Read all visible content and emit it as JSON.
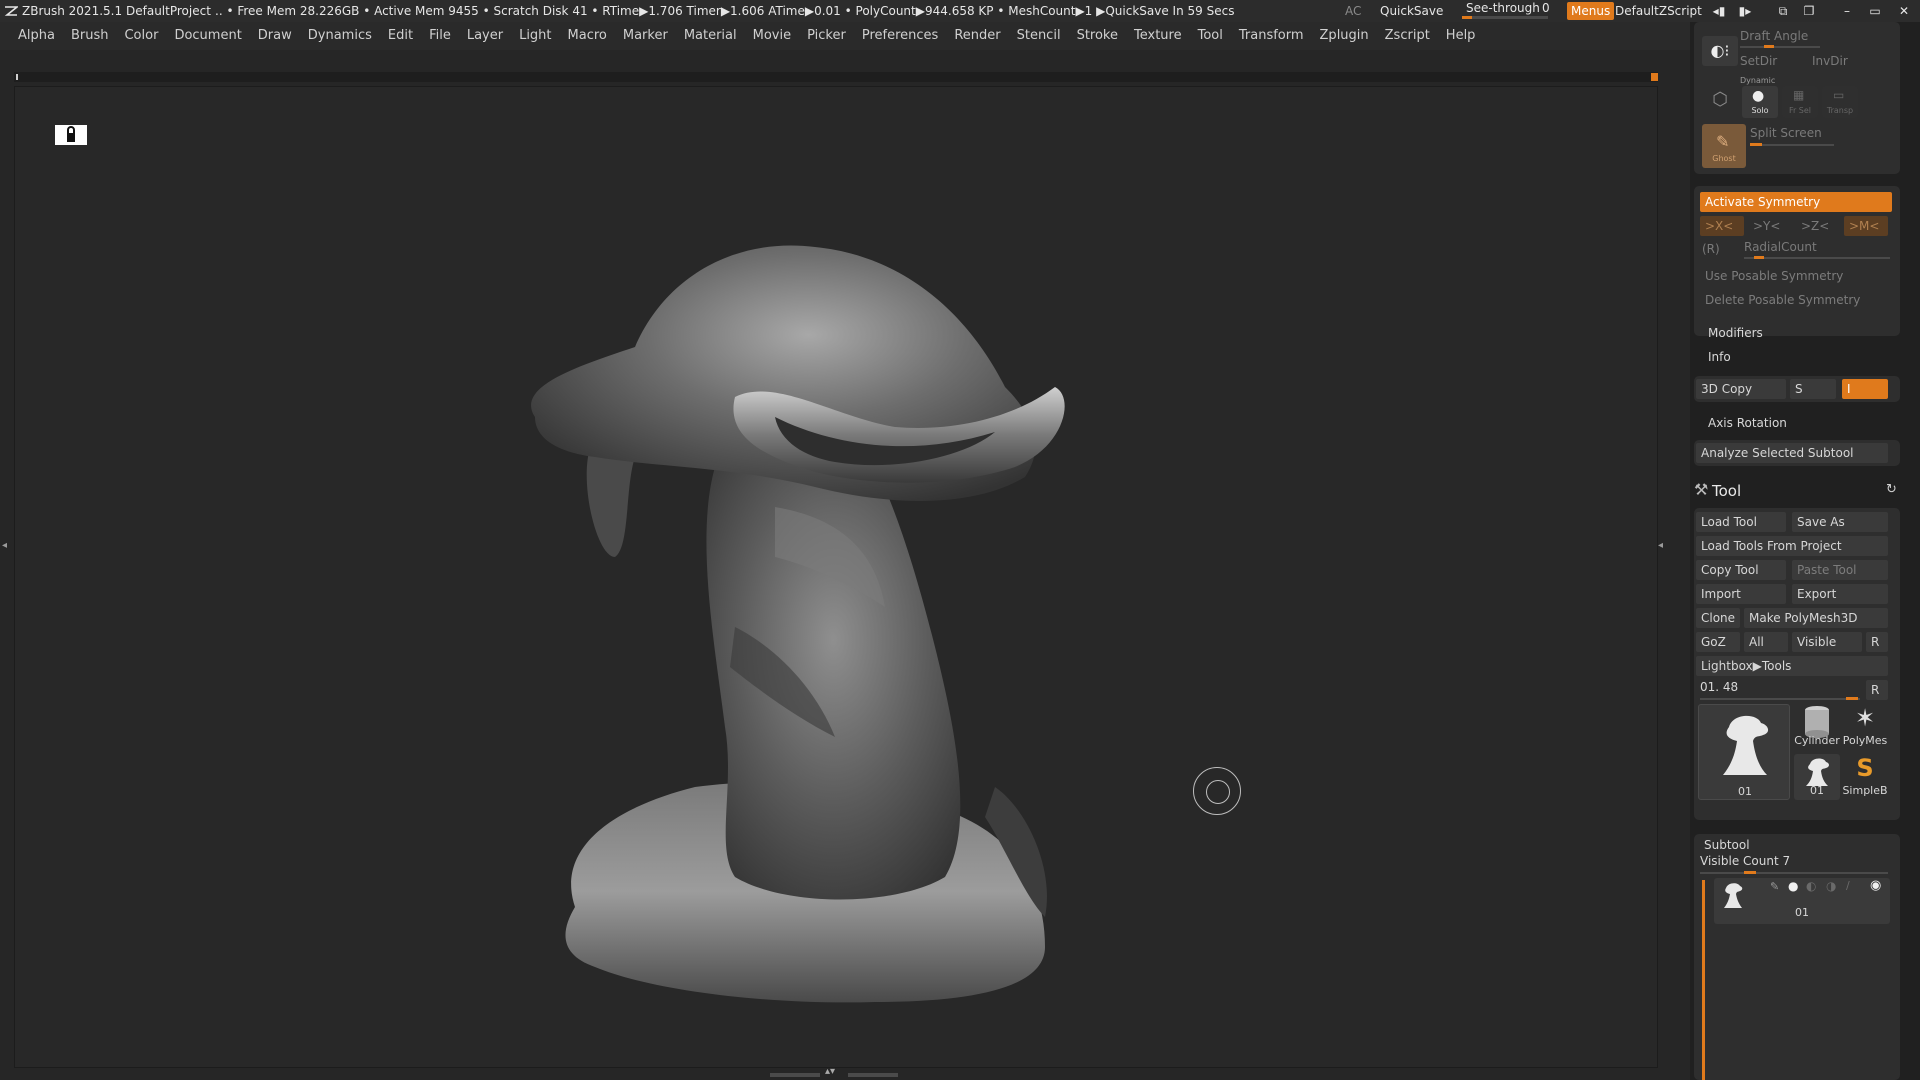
{
  "titlebar": {
    "app": "ZBrush 2021.5.1",
    "project": "DefaultProject",
    "stats": ".. • Free Mem 28.226GB • Active Mem 9455 • Scratch Disk 41 •  RTime▶1.706 Timer▶1.606 ATime▶0.01 • PolyCount▶944.658 KP • MeshCount▶1  ▶QuickSave In 59 Secs",
    "ac": "AC",
    "quicksave": "QuickSave",
    "seethrough_label": "See-through",
    "seethrough_value": "0",
    "menus": "Menus",
    "zscript": "DefaultZScript",
    "accent": "#e07a1c"
  },
  "menubar": [
    "Alpha",
    "Brush",
    "Color",
    "Document",
    "Draw",
    "Dynamics",
    "Edit",
    "File",
    "Layer",
    "Light",
    "Macro",
    "Marker",
    "Material",
    "Movie",
    "Picker",
    "Preferences",
    "Render",
    "Stencil",
    "Stroke",
    "Texture",
    "Tool",
    "Transform",
    "Zplugin",
    "Zscript",
    "Help"
  ],
  "top_panel": {
    "draft_angle": "Draft Angle",
    "setdir": "SetDir",
    "invdir": "InvDir",
    "dynamic": "Dynamic",
    "solo": "Solo",
    "frsel": "Fr Sel",
    "transp": "Transp",
    "ghost": "Ghost",
    "split_screen": "Split Screen"
  },
  "symmetry": {
    "activate": "Activate Symmetry",
    "x": ">X<",
    "y": ">Y<",
    "z": ">Z<",
    "m": ">M<",
    "r": "(R)",
    "radial": "RadialCount",
    "use_posable": "Use Posable Symmetry",
    "delete_posable": "Delete Posable Symmetry"
  },
  "modifiers": "Modifiers",
  "info": "Info",
  "copy3d": {
    "label": "3D Copy",
    "s": "S",
    "i": "I"
  },
  "axis_rotation": "Axis Rotation",
  "analyze": "Analyze Selected Subtool",
  "tool": {
    "title": "Tool",
    "load_tool": "Load Tool",
    "save_as": "Save As",
    "load_from_project": "Load Tools From Project",
    "copy_tool": "Copy Tool",
    "paste_tool": "Paste Tool",
    "import": "Import",
    "export": "Export",
    "clone": "Clone",
    "make_polymesh": "Make PolyMesh3D",
    "goz": "GoZ",
    "all": "All",
    "visible": "Visible",
    "r": "R",
    "lightbox": "Lightbox▶Tools",
    "current": "01. 48",
    "current_r": "R",
    "thumbs": [
      {
        "label": "01",
        "icon": "model-icon"
      },
      {
        "label": "Cylinder",
        "icon": "cylinder-icon"
      },
      {
        "label": "PolyMes",
        "icon": "star-icon"
      },
      {
        "label": "01",
        "icon": "model-icon"
      },
      {
        "label": "SimpleB",
        "icon": "simplebrush-icon"
      }
    ]
  },
  "subtool": {
    "title": "Subtool",
    "visible_count": "Visible Count 7",
    "item_label": "01"
  }
}
